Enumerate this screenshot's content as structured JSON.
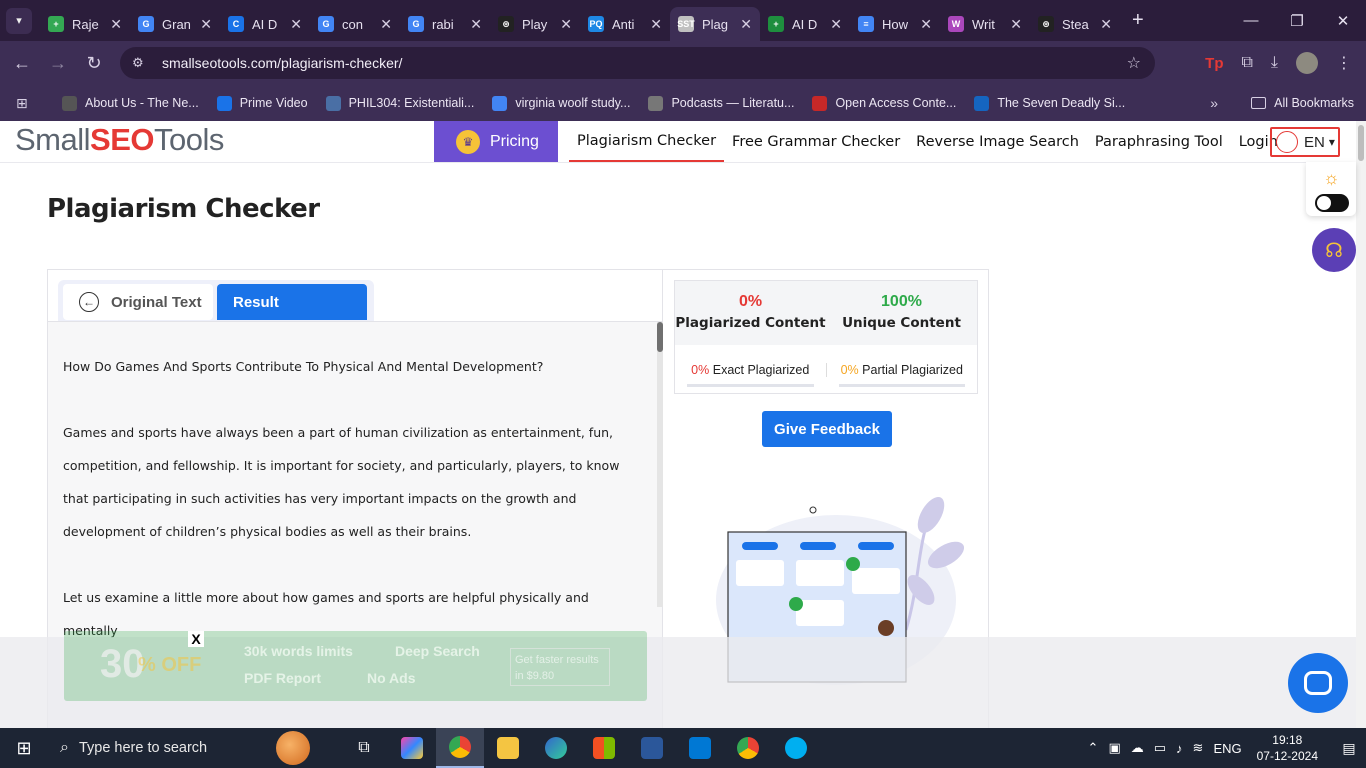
{
  "browser": {
    "tabs": [
      {
        "title": "Raje",
        "fav_color": "#34a853",
        "fav_glyph": "+"
      },
      {
        "title": "Gran",
        "fav_color": "#4285f4",
        "fav_glyph": "G"
      },
      {
        "title": "AI D",
        "fav_color": "#1a73e8",
        "fav_glyph": "C"
      },
      {
        "title": "con",
        "fav_color": "#4285f4",
        "fav_glyph": "G"
      },
      {
        "title": "rabi",
        "fav_color": "#4285f4",
        "fav_glyph": "G"
      },
      {
        "title": "Play",
        "fav_color": "#222222",
        "fav_glyph": "⊛"
      },
      {
        "title": "Anti",
        "fav_color": "#1e88e5",
        "fav_glyph": "PQ"
      },
      {
        "title": "Plag",
        "fav_color": "#c0c0c0",
        "fav_glyph": "SST"
      },
      {
        "title": "AI D",
        "fav_color": "#1e8e3e",
        "fav_glyph": "+"
      },
      {
        "title": "How",
        "fav_color": "#4285f4",
        "fav_glyph": "≡"
      },
      {
        "title": "Writ",
        "fav_color": "#ab47bc",
        "fav_glyph": "W"
      },
      {
        "title": "Stea",
        "fav_color": "#222222",
        "fav_glyph": "⊛"
      }
    ],
    "active_tab_index": 7,
    "url": "smallseotools.com/plagiarism-checker/",
    "bookmarks": [
      {
        "label": "About Us - The Ne...",
        "color": "#555555"
      },
      {
        "label": "Prime Video",
        "color": "#1a73e8"
      },
      {
        "label": "PHIL304: Existentiali...",
        "color": "#4a6fa5"
      },
      {
        "label": "virginia woolf study...",
        "color": "#4285f4"
      },
      {
        "label": "Podcasts — Literatu...",
        "color": "#777777"
      },
      {
        "label": "Open Access Conte...",
        "color": "#c62828"
      },
      {
        "label": "The Seven Deadly Si...",
        "color": "#1565c0"
      }
    ],
    "all_bookmarks_label": "All Bookmarks",
    "tp_label": "Tp"
  },
  "site": {
    "logo_prefix": "Small",
    "logo_mid": "SEO",
    "logo_suffix": "Tools",
    "pricing_label": "Pricing",
    "nav": [
      "Plagiarism Checker",
      "Free Grammar Checker",
      "Reverse Image Search",
      "Paraphrasing Tool",
      "Login"
    ],
    "active_nav_index": 0,
    "lang": "EN",
    "page_title": "Plagiarism Checker"
  },
  "checker": {
    "tab_original": "Original Text",
    "tab_result": "Result",
    "paragraphs": [
      "How Do Games And Sports Contribute To Physical And Mental Development?",
      "",
      "Games and sports have always been a part of human civilization as entertainment, fun, competition, and fellowship. It is important for society, and particularly, players, to know that participating in such activities has very important impacts on the growth and development of children’s physical bodies as well as their brains.",
      "",
      "Let us examine a little more about how games and sports are helpful physically and mentally"
    ],
    "plagiarized_pct": "0%",
    "plagiarized_label": "Plagiarized Content",
    "unique_pct": "100%",
    "unique_label": "Unique Content",
    "exact_pct": "0%",
    "exact_label": "Exact Plagiarized",
    "partial_pct": "0%",
    "partial_label": "Partial Plagiarized",
    "feedback_label": "Give Feedback"
  },
  "promo": {
    "big": "30",
    "off": "% OFF",
    "feature1": "30k words limits",
    "feature2": "Deep Search",
    "feature3": "PDF Report",
    "feature4": "No Ads",
    "cta": "Get faster results in $9.80",
    "close": "X"
  },
  "taskbar": {
    "search_placeholder": "Type here to search",
    "lang": "ENG",
    "time": "19:18",
    "date": "07-12-2024"
  },
  "colors": {
    "red": "#e53935",
    "green": "#2eaa4a",
    "orange": "#f5a623",
    "blue": "#1a73e8",
    "purple": "#6c4fd1"
  }
}
